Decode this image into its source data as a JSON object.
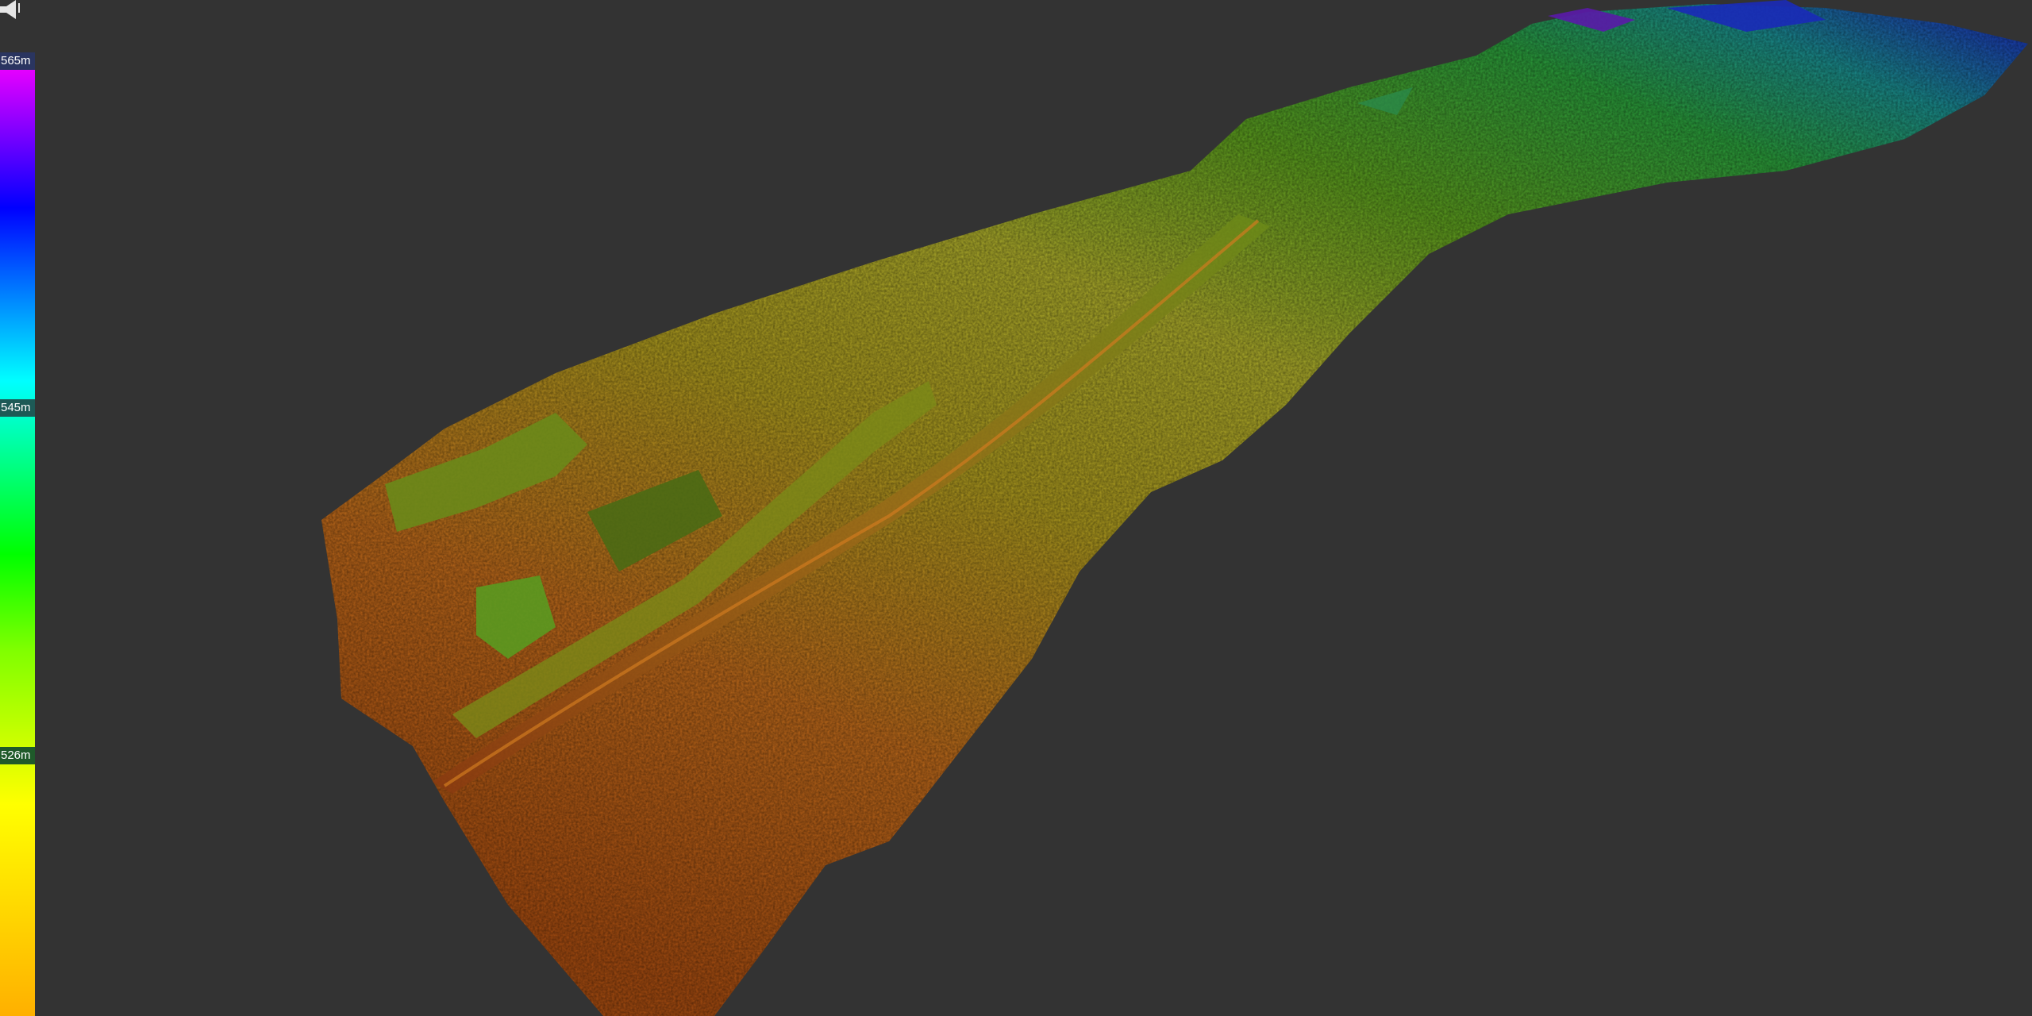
{
  "legend": {
    "top_label": "565m",
    "mid_label": "545m",
    "bottom_label": "526m"
  },
  "icons": {
    "corner": "speaker-icon"
  },
  "colors": {
    "background": "#333333",
    "ramp": [
      "#ff00ff",
      "#0000ff",
      "#00ffff",
      "#00ff00",
      "#ffff00",
      "#ff8000"
    ]
  }
}
